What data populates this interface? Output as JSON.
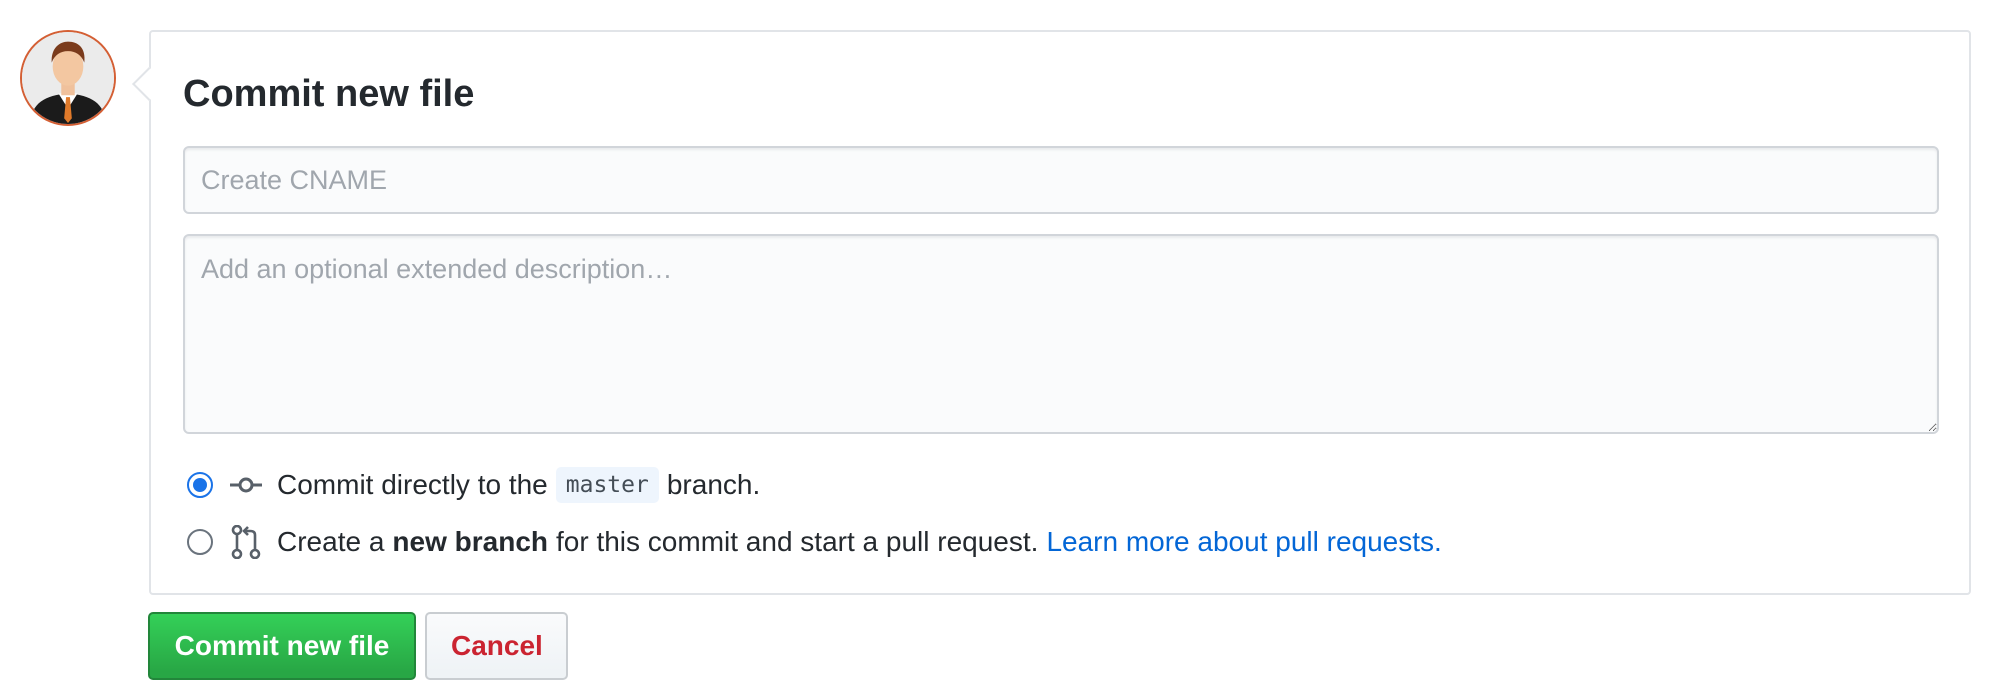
{
  "avatar": {
    "icon": "user-avatar-icon"
  },
  "commit": {
    "title": "Commit new file",
    "summary": {
      "placeholder": "Create CNAME",
      "value": ""
    },
    "description": {
      "placeholder": "Add an optional extended description…",
      "value": ""
    },
    "options": [
      {
        "selected": true,
        "icon": "git-commit-icon",
        "text_before": "Commit directly to the",
        "branch": "master",
        "text_after": "branch."
      },
      {
        "selected": false,
        "icon": "git-pull-request-icon",
        "text_before": "Create a",
        "bold": "new branch",
        "text_after": "for this commit and start a pull request.",
        "link": "Learn more about pull requests."
      }
    ]
  },
  "buttons": {
    "commit_label": "Commit new file",
    "cancel_label": "Cancel"
  },
  "colors": {
    "primary_green": "#28a745",
    "cancel_red": "#cb2431",
    "link_blue": "#0366d6",
    "radio_blue": "#1a73e8"
  }
}
